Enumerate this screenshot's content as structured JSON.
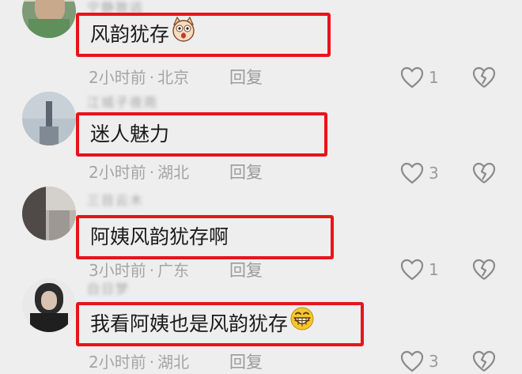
{
  "comments": [
    {
      "username": "宁静致远",
      "text": "风韵犹存",
      "emoji": "surprised-cat-emoji",
      "time": "2小时前",
      "location": "北京",
      "reply_label": "回复",
      "likes": "1"
    },
    {
      "username": "江城子夜雨",
      "text": "迷人魅力",
      "emoji": "",
      "time": "2小时前",
      "location": "湖北",
      "reply_label": "回复",
      "likes": "3"
    },
    {
      "username": "三目云木",
      "text": "阿姨风韵犹存啊",
      "emoji": "",
      "time": "3小时前",
      "location": "广东",
      "reply_label": "回复",
      "likes": "1"
    },
    {
      "username": "白日梦",
      "text": "我看阿姨也是风韵犹存",
      "emoji": "grinning-emoji",
      "time": "2小时前",
      "location": "湖北",
      "reply_label": "回复",
      "likes": "3"
    }
  ],
  "colors": {
    "highlight": "#e8141b",
    "meta": "#a5a5a5",
    "background": "#eeeeee"
  }
}
